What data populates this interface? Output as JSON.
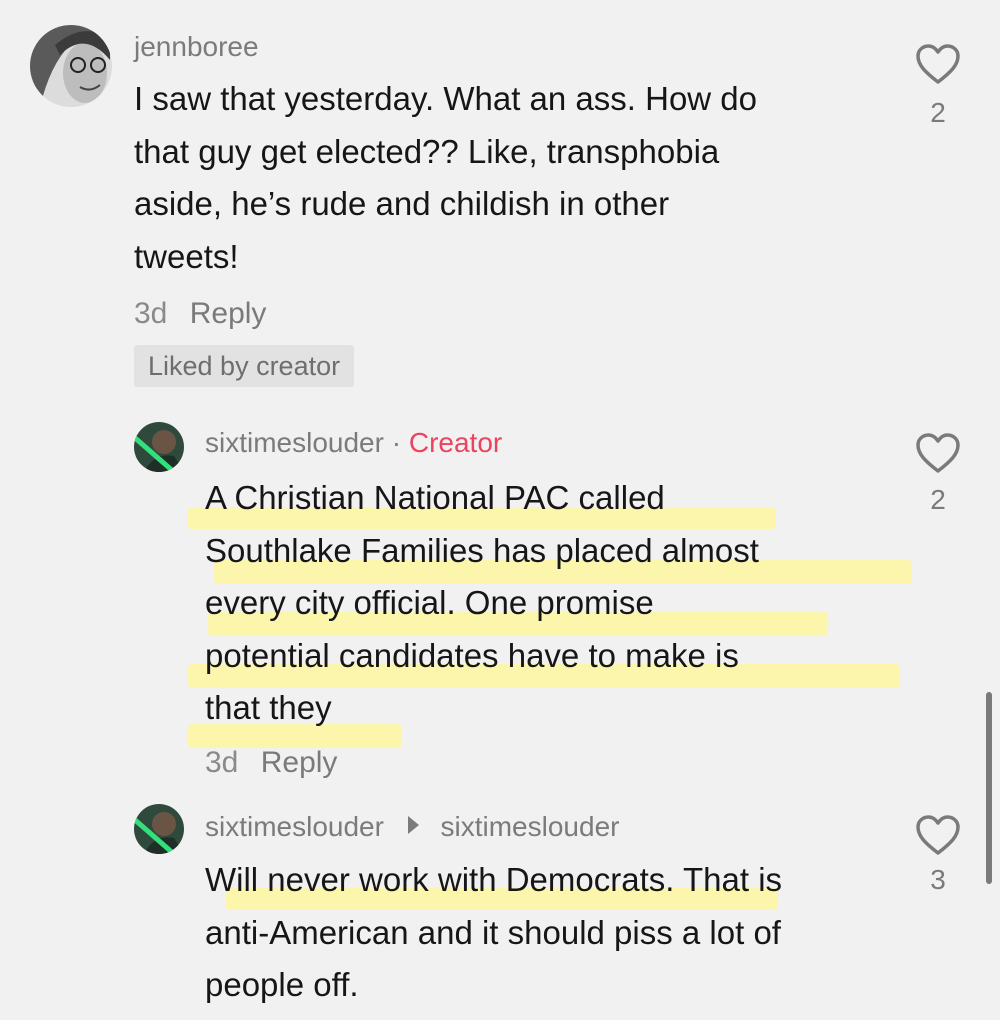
{
  "comments": [
    {
      "username": "jennboree",
      "lines": [
        "I saw that yesterday. What an ass. How do",
        "that guy get elected?? Like, transphobia",
        "aside, he’s rude and childish in other",
        "tweets!"
      ],
      "time": "3d",
      "reply_label": "Reply",
      "badge": "Liked by creator",
      "likes": "2",
      "avatar_icon": "user-avatar-icon"
    },
    {
      "username": "sixtimeslouder",
      "separator": "·",
      "creator_label": "Creator",
      "lines": [
        "A Christian National PAC called",
        "Southlake Families has placed almost",
        "every city official. One promise",
        "potential candidates have to make is",
        "that they"
      ],
      "time": "3d",
      "reply_label": "Reply",
      "likes": "2",
      "avatar_icon": "user-avatar-icon"
    },
    {
      "username": "sixtimeslouder",
      "reply_to": "sixtimeslouder",
      "lines": [
        "Will never work with Democrats. That is",
        "anti-American and it should piss a lot of",
        "people off."
      ],
      "likes": "3",
      "avatar_icon": "user-avatar-icon"
    }
  ],
  "colors": {
    "background": "#f1f1f1",
    "creator": "#ea4461",
    "highlight": "#fff796"
  }
}
